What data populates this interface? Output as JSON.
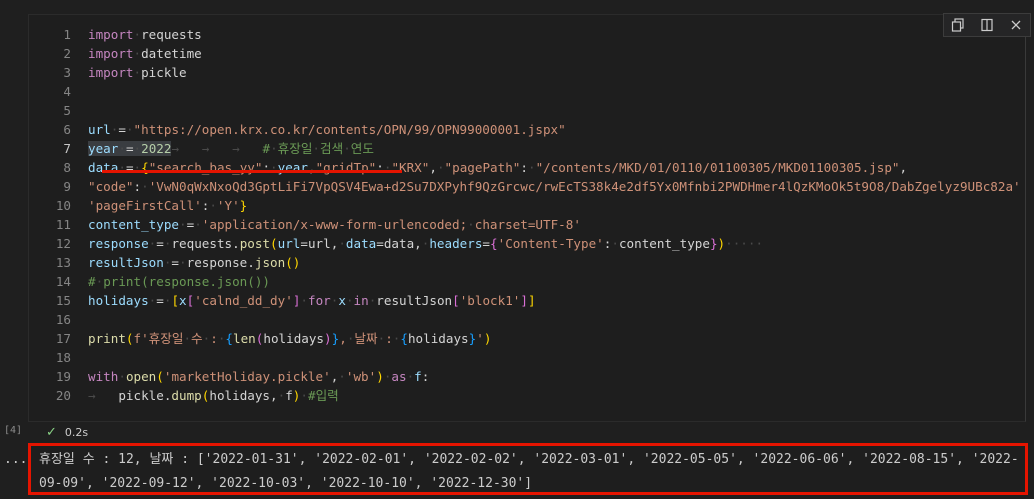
{
  "toolbar": {
    "icons": [
      "copy-icon",
      "split-cell-icon",
      "close-icon"
    ]
  },
  "code_lines": [
    {
      "n": "1",
      "html": "<span class=\"kw\">import</span><span class=\"ws\">·</span>requests"
    },
    {
      "n": "2",
      "html": "<span class=\"kw\">import</span><span class=\"ws\">·</span>datetime"
    },
    {
      "n": "3",
      "html": "<span class=\"kw\">import</span><span class=\"ws\">·</span>pickle"
    },
    {
      "n": "4",
      "html": ""
    },
    {
      "n": "5",
      "html": ""
    },
    {
      "n": "6",
      "html": "<span class=\"vr\">url</span><span class=\"ws\">·</span>=<span class=\"ws\">·</span><span class=\"st\">\"https://open.krx.co.kr/contents/OPN/99/OPN99000001.jspx\"</span>"
    },
    {
      "n": "7",
      "html": "<span class=\"sel\"><span class=\"vr\">year</span><span class=\"ws\">·</span>=<span class=\"ws\">·</span><span class=\"nm\">2022</span></span><span class=\"ws\">→   →   →   </span><span class=\"cm\">#<span class=\"ws\">·</span>휴장일<span class=\"ws\">·</span>검색<span class=\"ws\">·</span>연도</span>"
    },
    {
      "n": "8",
      "html": "<span class=\"vr\">data</span><span class=\"ws\">·</span>=<span class=\"ws\">·</span><span class=\"br1\">{</span><span class=\"st\">\"search_bas_yy\"</span>:<span class=\"ws\">·</span><span class=\"vr\">year</span>,<span class=\"st\">\"gridTp\"</span>:<span class=\"ws\">·</span><span class=\"st\">\"KRX\"</span>,<span class=\"ws\">·</span><span class=\"st\">\"pagePath\"</span>:<span class=\"ws\">·</span><span class=\"st\">\"/contents/MKD/01/0110/01100305/MKD01100305.jsp\"</span>,"
    },
    {
      "n": "9",
      "html": "<span class=\"st\">\"code\"</span>:<span class=\"ws\">·</span><span class=\"st\">'VwN0qWxNxoQd3GptLiFi7VpQSV4Ewa+d2Su7DXPyhf9QzGrcwc/rwEcTS38k4e2df5Yx0Mfnbi2PWDHmer4lQzKMoOk5t9O8/DabZgelyz9UBc82a'</span>"
    },
    {
      "n": "10",
      "html": "<span class=\"st\">'pageFirstCall'</span>:<span class=\"ws\">·</span><span class=\"st\">'Y'</span><span class=\"br1\">}</span>"
    },
    {
      "n": "11",
      "html": "<span class=\"vr\">content_type</span><span class=\"ws\">·</span>=<span class=\"ws\">·</span><span class=\"st\">'application/x-www-form-urlencoded;<span class=\"ws\">·</span>charset=UTF-8'</span>"
    },
    {
      "n": "12",
      "html": "<span class=\"vr\">response</span><span class=\"ws\">·</span>=<span class=\"ws\">·</span>requests.<span class=\"fn\">post</span><span class=\"br1\">(</span><span class=\"vr\">url</span>=url,<span class=\"ws\">·</span><span class=\"vr\">data</span>=data,<span class=\"ws\">·</span><span class=\"vr\">headers</span>=<span class=\"br2\">{</span><span class=\"st\">'Content-Type'</span>:<span class=\"ws\">·</span>content_type<span class=\"br2\">}</span><span class=\"br1\">)</span><span class=\"ws\">·····</span>"
    },
    {
      "n": "13",
      "html": "<span class=\"vr\">resultJson</span><span class=\"ws\">·</span>=<span class=\"ws\">·</span>response.<span class=\"fn\">json</span><span class=\"br1\">()</span>"
    },
    {
      "n": "14",
      "html": "<span class=\"cm\">#<span class=\"ws\">·</span>print(response.json())</span>"
    },
    {
      "n": "15",
      "html": "<span class=\"vr\">holidays</span><span class=\"ws\">·</span>=<span class=\"ws\">·</span><span class=\"br1\">[</span><span class=\"vr\">x</span><span class=\"br2\">[</span><span class=\"st\">'calnd_dd_dy'</span><span class=\"br2\">]</span><span class=\"ws\">·</span><span class=\"kw\">for</span><span class=\"ws\">·</span><span class=\"vr\">x</span><span class=\"ws\">·</span><span class=\"kw\">in</span><span class=\"ws\">·</span>resultJson<span class=\"br2\">[</span><span class=\"st\">'block1'</span><span class=\"br2\">]</span><span class=\"br1\">]</span>"
    },
    {
      "n": "16",
      "html": ""
    },
    {
      "n": "17",
      "html": "<span class=\"fn\">print</span><span class=\"br1\">(</span><span class=\"st\">f'휴장일<span class=\"ws\">·</span>수<span class=\"ws\">·</span>:<span class=\"ws\">·</span></span><span class=\"br3\">{</span><span class=\"fn\">len</span><span class=\"br2\">(</span>holidays<span class=\"br2\">)</span><span class=\"br3\">}</span><span class=\"st\">,<span class=\"ws\">·</span>날짜<span class=\"ws\">·</span>:<span class=\"ws\">·</span></span><span class=\"br3\">{</span>holidays<span class=\"br3\">}</span><span class=\"st\">'</span><span class=\"br1\">)</span>"
    },
    {
      "n": "18",
      "html": ""
    },
    {
      "n": "19",
      "html": "<span class=\"kw\">with</span><span class=\"ws\">·</span><span class=\"fn\">open</span><span class=\"br1\">(</span><span class=\"st\">'marketHoliday.pickle'</span>,<span class=\"ws\">·</span><span class=\"st\">'wb'</span><span class=\"br1\">)</span><span class=\"ws\">·</span><span class=\"kw\">as</span><span class=\"ws\">·</span><span class=\"vr\">f</span>:"
    },
    {
      "n": "20",
      "html": "<span class=\"ws\">→   </span>pickle.<span class=\"fn\">dump</span><span class=\"br1\">(</span>holidays,<span class=\"ws\">·</span>f<span class=\"br1\">)</span><span class=\"ws\">·</span><span class=\"cm\">#입력</span>"
    }
  ],
  "active_line": "7",
  "exec": {
    "count": "[4]",
    "time": "0.2s"
  },
  "output": {
    "dots": "...",
    "line1": "휴장일 수 : 12, 날짜 : ['2022-01-31', '2022-02-01', '2022-02-02', '2022-03-01', '2022-05-05', '2022-06-06', '2022-08-15', '2022-",
    "line2": "09-09', '2022-09-12', '2022-10-03', '2022-10-10', '2022-12-30']"
  }
}
